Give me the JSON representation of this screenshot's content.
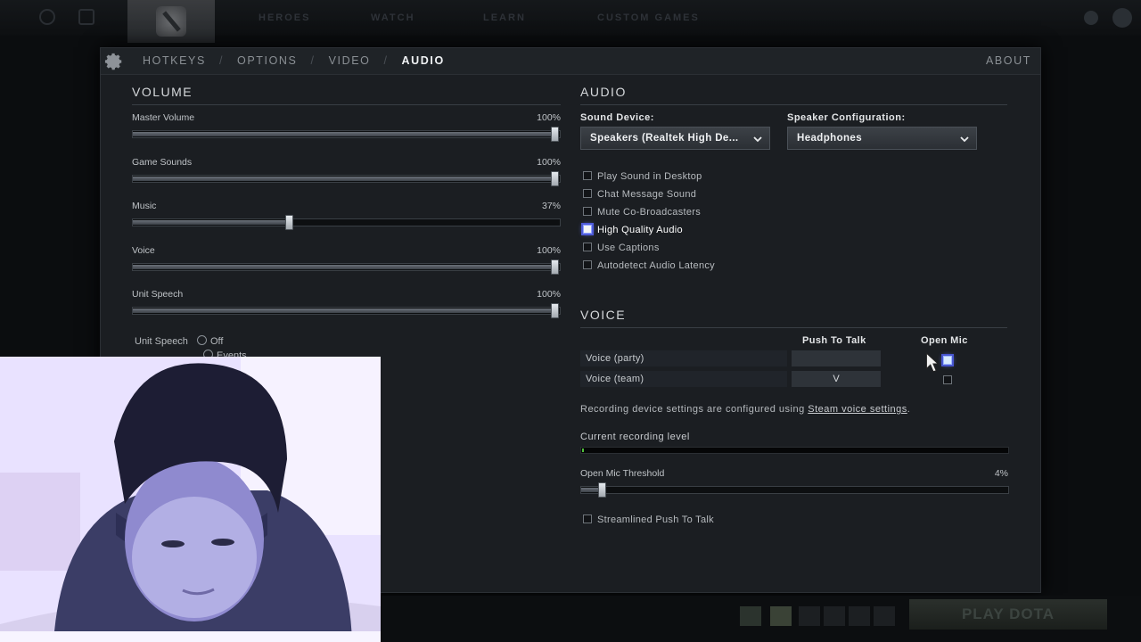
{
  "top_nav": [
    "HEROES",
    "WATCH",
    "LEARN",
    "CUSTOM GAMES"
  ],
  "tabs": [
    {
      "label": "HOTKEYS",
      "active": false
    },
    {
      "label": "OPTIONS",
      "active": false
    },
    {
      "label": "VIDEO",
      "active": false
    },
    {
      "label": "AUDIO",
      "active": true
    }
  ],
  "tab_separator": "/",
  "about_label": "ABOUT",
  "volume": {
    "title": "VOLUME",
    "sliders": [
      {
        "label": "Master Volume",
        "value": "100%",
        "level": 1.0
      },
      {
        "label": "Game Sounds",
        "value": "100%",
        "level": 1.0
      },
      {
        "label": "Music",
        "value": "37%",
        "level": 0.37
      },
      {
        "label": "Voice",
        "value": "100%",
        "level": 1.0
      },
      {
        "label": "Unit Speech",
        "value": "100%",
        "level": 1.0
      }
    ],
    "unit_speech_setting": {
      "label": "Unit Speech",
      "options": [
        "Off",
        "Events"
      ]
    }
  },
  "audio": {
    "title": "AUDIO",
    "sound_device_label": "Sound Device:",
    "sound_device_value": "Speakers (Realtek High De...",
    "speaker_config_label": "Speaker Configuration:",
    "speaker_config_value": "Headphones",
    "checkboxes": [
      {
        "label": "Play Sound in Desktop",
        "checked": false,
        "focused": false
      },
      {
        "label": "Chat Message Sound",
        "checked": false,
        "focused": false
      },
      {
        "label": "Mute Co-Broadcasters",
        "checked": false,
        "focused": false
      },
      {
        "label": "High Quality Audio",
        "checked": true,
        "focused": true
      },
      {
        "label": "Use Captions",
        "checked": false,
        "focused": false
      },
      {
        "label": "Autodetect Audio Latency",
        "checked": false,
        "focused": false
      }
    ]
  },
  "voice": {
    "title": "VOICE",
    "col_push_to_talk": "Push To Talk",
    "col_open_mic": "Open Mic",
    "rows": [
      {
        "label": "Voice (party)",
        "key": "",
        "open_mic": true
      },
      {
        "label": "Voice (team)",
        "key": "V",
        "open_mic": false
      }
    ],
    "recording_note_prefix": "Recording device settings are configured using ",
    "recording_note_link": "Steam voice settings",
    "recording_note_suffix": ".",
    "recording_level_label": "Current recording level",
    "recording_level": 0.01,
    "threshold_label": "Open Mic Threshold",
    "threshold_value": "4%",
    "threshold_level": 0.04,
    "streamlined_label": "Streamlined Push To Talk"
  },
  "play_button_label": "PLAY DOTA",
  "colors": {
    "panel_bg": "#1b1e22",
    "focus": "#4e5bd8",
    "level_green": "#4fbf3a"
  }
}
